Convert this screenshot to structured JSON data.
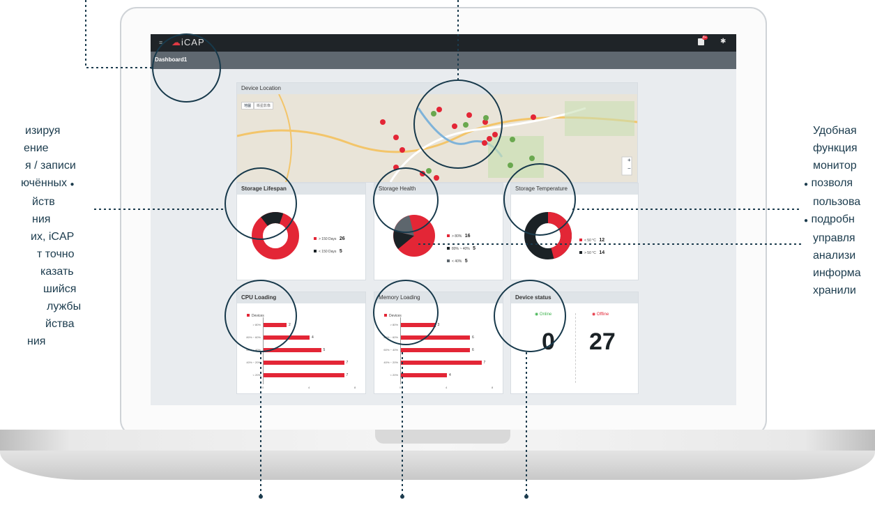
{
  "app": {
    "name": "iCAP",
    "notification_count": "8+",
    "breadcrumb": "Dashboard1"
  },
  "location": {
    "title": "Device Location",
    "map_btn": "地圖",
    "sat_btn": "衛星影像",
    "zoom_in": "+",
    "zoom_out": "−"
  },
  "lifespan": {
    "title": "Storage Lifespan",
    "items": [
      {
        "label": "> 150 Days",
        "value": "26",
        "color": "#e32636"
      },
      {
        "label": "< 150 Days",
        "value": "5",
        "color": "#1b2226"
      }
    ]
  },
  "health": {
    "title": "Storage Health",
    "items": [
      {
        "label": "> 80%",
        "value": "16",
        "color": "#e32636"
      },
      {
        "label": "80% ~ 40%",
        "value": "5",
        "color": "#1b2226"
      },
      {
        "label": "< 40%",
        "value": "5",
        "color": "#5d666d"
      }
    ]
  },
  "temperature": {
    "title": "Storage Temperature",
    "items": [
      {
        "label": "< 50 °C",
        "value": "12",
        "color": "#e32636"
      },
      {
        "label": "> 50 °C",
        "value": "14",
        "color": "#1b2226"
      }
    ]
  },
  "cpu": {
    "title": "CPU Loading",
    "legend": "Devices",
    "categories": [
      "> 80%",
      "80% ~ 60%",
      "60% ~ 40%",
      "40% ~ 20%",
      "< 20%"
    ],
    "values": [
      2,
      4,
      5,
      7,
      7
    ],
    "x_ticks": [
      "0",
      "4",
      "8"
    ]
  },
  "memory": {
    "title": "Memory Loading",
    "legend": "Devices",
    "categories": [
      "> 80%",
      "80% ~ 60%",
      "60% ~ 40%",
      "40% ~ 20%",
      "< 20%"
    ],
    "values": [
      3,
      6,
      6,
      7,
      4
    ],
    "x_ticks": [
      "0",
      "4",
      "8"
    ]
  },
  "status": {
    "title": "Device status",
    "online_label": "Online",
    "offline_label": "Offline",
    "online_value": "0",
    "offline_value": "27"
  },
  "left_text": [
    "изируя",
    "ение",
    "я / записи",
    "ючённых",
    "йств",
    "ния",
    "их, iCAP",
    "т точно",
    "казать",
    "шийся",
    "лужбы",
    "йства",
    "ния"
  ],
  "right_text": [
    "Удобная",
    "функция",
    "монитор",
    "позволя",
    "пользова",
    "подробн",
    "управля",
    "анализи",
    "информа",
    "хранили"
  ],
  "colors": {
    "accent": "#e32636",
    "dark": "#1b2226",
    "grey": "#5d666d",
    "online": "#3fb34f",
    "annotation": "#1b3b4d"
  }
}
